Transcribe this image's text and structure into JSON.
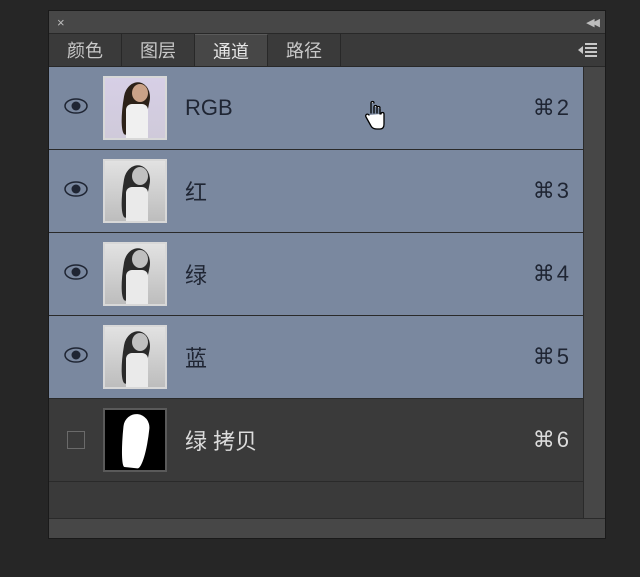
{
  "titlebar": {
    "close_label": "×"
  },
  "tabs": [
    {
      "label": "颜色",
      "active": false
    },
    {
      "label": "图层",
      "active": false
    },
    {
      "label": "通道",
      "active": true
    },
    {
      "label": "路径",
      "active": false
    }
  ],
  "channels": [
    {
      "name": "RGB",
      "shortcut_symbol": "⌘",
      "shortcut_key": "2",
      "selected": true,
      "visible": true,
      "thumb": "rgb"
    },
    {
      "name": "红",
      "shortcut_symbol": "⌘",
      "shortcut_key": "3",
      "selected": true,
      "visible": true,
      "thumb": "gray"
    },
    {
      "name": "绿",
      "shortcut_symbol": "⌘",
      "shortcut_key": "4",
      "selected": true,
      "visible": true,
      "thumb": "gray"
    },
    {
      "name": "蓝",
      "shortcut_symbol": "⌘",
      "shortcut_key": "5",
      "selected": true,
      "visible": true,
      "thumb": "gray"
    },
    {
      "name": "绿 拷贝",
      "shortcut_symbol": "⌘",
      "shortcut_key": "6",
      "selected": false,
      "visible": false,
      "thumb": "mask"
    }
  ]
}
